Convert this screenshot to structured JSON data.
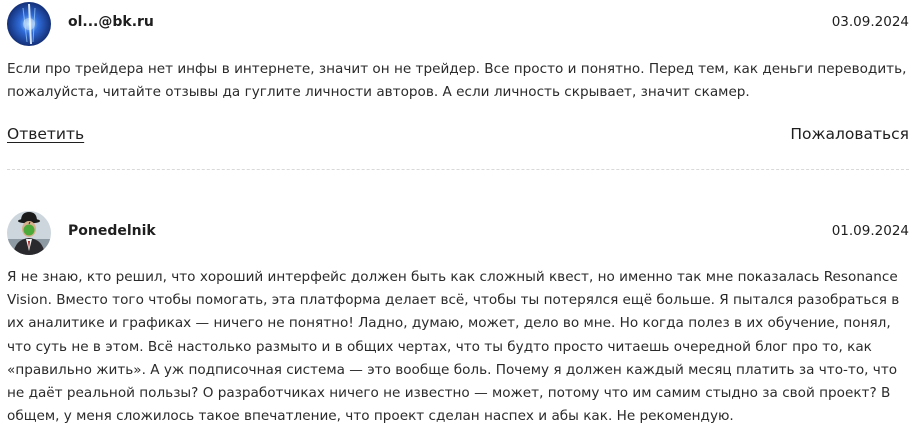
{
  "reviews": [
    {
      "author": "ol...@bk.ru",
      "date": "03.09.2024",
      "text": "Если про трейдера нет инфы в интернете, значит он не трейдер. Все просто и понятно. Перед тем, как деньги переводить, пожалуйста, читайте отзывы да гуглите личности авторов. А если личность скрывает, значит скамер.",
      "reply_label": "Ответить",
      "report_label": "Пожаловаться"
    },
    {
      "author": "Ponedelnik",
      "date": "01.09.2024",
      "text": "Я не знаю, кто решил, что хороший интерфейс должен быть как сложный квест, но именно так мне показалась Resonance Vision. Вместо того чтобы помогать, эта платформа делает всё, чтобы ты потерялся ещё больше. Я пытался разобраться в их аналитике и графиках — ничего не понятно! Ладно, думаю, может, дело во мне. Но когда полез в их обучение, понял, что суть не в этом. Всё настолько размыто и в общих чертах, что ты будто просто читаешь очередной блог про то, как «правильно жить». А уж подписочная система — это вообще боль. Почему я должен каждый месяц платить за что-то, что не даёт реальной пользы? О разработчиках ничего не известно — может, потому что им самим стыдно за свой проект? В общем, у меня сложилось такое впечатление, что проект сделан наспех и абы как. Не рекомендую."
    }
  ]
}
